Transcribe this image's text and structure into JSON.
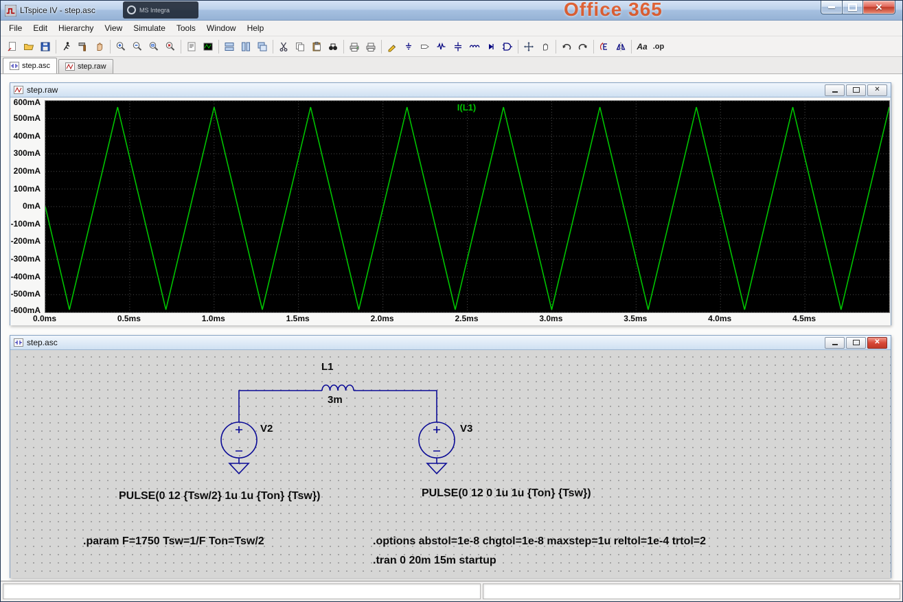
{
  "titlebar": {
    "title": "LTspice IV - step.asc",
    "background_brand": "Office 365",
    "background_fragment": "MS Integra"
  },
  "menubar": {
    "items": [
      "File",
      "Edit",
      "Hierarchy",
      "View",
      "Simulate",
      "Tools",
      "Window",
      "Help"
    ]
  },
  "toolbar": {
    "text_label": "Aa",
    "op_label": ".op"
  },
  "tabs": [
    {
      "label": "step.asc"
    },
    {
      "label": "step.raw"
    }
  ],
  "waveform_window": {
    "title": "step.raw"
  },
  "schematic_window": {
    "title": "step.asc",
    "inductor_ref": "L1",
    "inductor_value": "3m",
    "v2_ref": "V2",
    "v2_value": "PULSE(0 12 {Tsw/2} 1u 1u {Ton} {Tsw})",
    "v3_ref": "V3",
    "v3_value": "PULSE(0 12 0 1u 1u {Ton} {Tsw})",
    "directive_param": ".param F=1750 Tsw=1/F Ton=Tsw/2",
    "directive_options": ".options abstol=1e-8 chgtol=1e-8 maxstep=1u reltol=1e-4 trtol=2",
    "directive_tran": ".tran 0 20m 15m startup"
  },
  "chart_data": {
    "type": "line",
    "title": "I(L1)",
    "legend": [
      "I(L1)"
    ],
    "trace_color": "#00c400",
    "background": "#000000",
    "grid": true,
    "x_unit": "ms",
    "y_unit": "mA",
    "x_range_ms": [
      0,
      5.0
    ],
    "x_tick_step_ms": 0.5,
    "y_range_mA": [
      -600,
      600
    ],
    "y_tick_step_mA": 100,
    "x_tick_labels": [
      "0.0ms",
      "0.5ms",
      "1.0ms",
      "1.5ms",
      "2.0ms",
      "2.5ms",
      "3.0ms",
      "3.5ms",
      "4.0ms",
      "4.5ms"
    ],
    "y_tick_labels": [
      "600mA",
      "500mA",
      "400mA",
      "300mA",
      "200mA",
      "100mA",
      "0mA",
      "-100mA",
      "-200mA",
      "-300mA",
      "-400mA",
      "-500mA",
      "-600mA"
    ],
    "series": [
      {
        "name": "I(L1)",
        "waveform": "triangle",
        "start_ms": 0,
        "start_mA": 0,
        "first_extreme": "min",
        "first_extreme_ms": 0.142857,
        "half_period_ms": 0.285714,
        "period_ms": 0.571429,
        "min_mA": -585,
        "max_mA": 565,
        "end_ms": 5.0
      }
    ]
  }
}
